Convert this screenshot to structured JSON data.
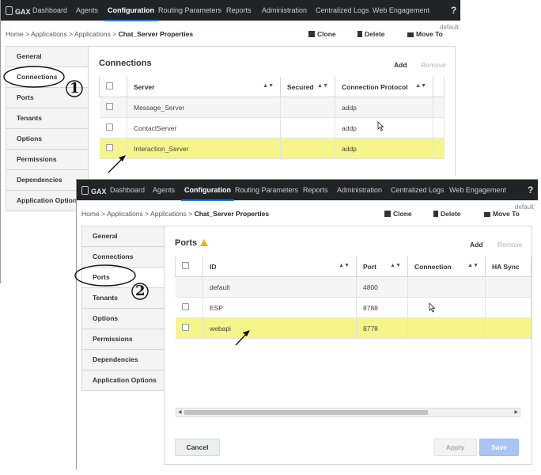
{
  "app": {
    "logo": "GAX"
  },
  "nav": {
    "items": [
      "Dashboard",
      "Agents",
      "Configuration",
      "Routing Parameters",
      "Reports",
      "Administration",
      "Centralized Logs",
      "Web Engagement"
    ],
    "active": "Configuration",
    "help": "?"
  },
  "breadcrumb": {
    "home": "Home",
    "sep": ">",
    "applications1": "Applications",
    "applications2": "Applications",
    "current": "Chat_Server Properties"
  },
  "toolbar": {
    "clone": "Clone",
    "delete": "Delete",
    "move_to": "Move To",
    "default_label": "default"
  },
  "sidebar": {
    "items": [
      "General",
      "Connections",
      "Ports",
      "Tenants",
      "Options",
      "Permissions",
      "Dependencies",
      "Application Options"
    ]
  },
  "connections": {
    "title": "Connections",
    "add": "Add",
    "remove": "Remove",
    "columns": [
      "Server",
      "Secured",
      "Connection Protocol"
    ],
    "rows": [
      {
        "server": "Message_Server",
        "secured": "",
        "protocol": "addp"
      },
      {
        "server": "ContactServer",
        "secured": "",
        "protocol": "addp"
      },
      {
        "server": "Interaction_Server",
        "secured": "",
        "protocol": "addp"
      }
    ]
  },
  "ports": {
    "title": "Ports",
    "add": "Add",
    "remove": "Remove",
    "columns": [
      "ID",
      "Port",
      "Connection",
      "HA Sync"
    ],
    "rows": [
      {
        "id": "default",
        "port": "4800",
        "connection": "",
        "ha_sync": ""
      },
      {
        "id": "ESP",
        "port": "8788",
        "connection": "",
        "ha_sync": ""
      },
      {
        "id": "webapi",
        "port": "8778",
        "connection": "",
        "ha_sync": ""
      }
    ]
  },
  "footer": {
    "cancel": "Cancel",
    "apply": "Apply",
    "save": "Save"
  },
  "annotations": {
    "step1": "1",
    "step2": "2"
  },
  "colors": {
    "nav_bg": "#222326",
    "active_underline": "#2c7be5",
    "highlight_row": "#f6f58a",
    "save_button": "#a9c5f5",
    "warning": "#f0ad1e"
  }
}
